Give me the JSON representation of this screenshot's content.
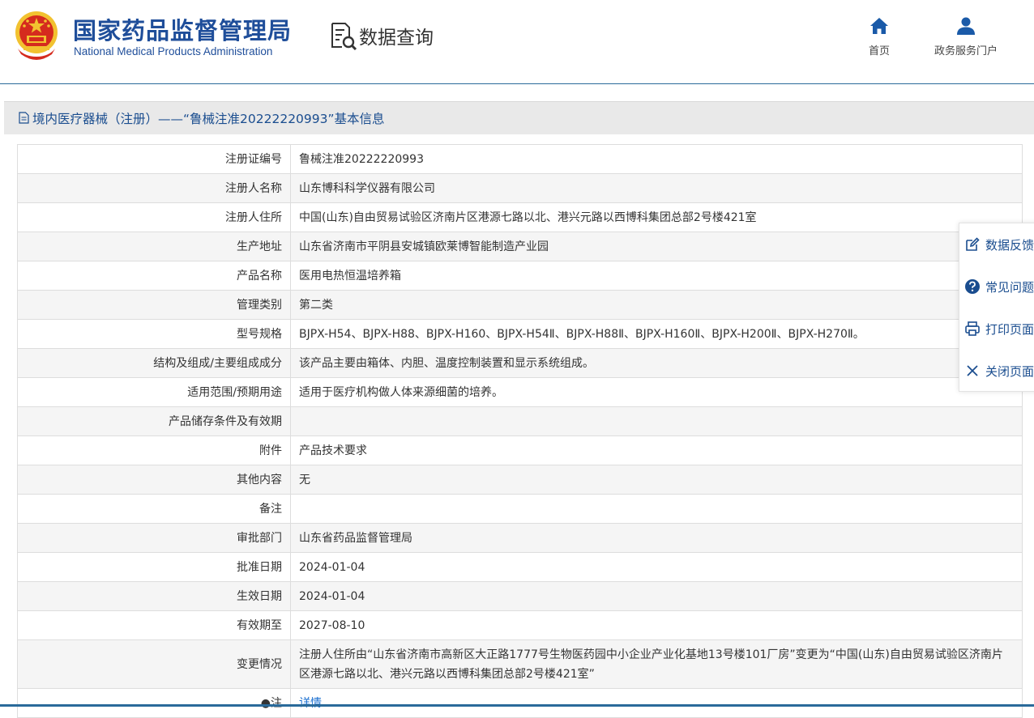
{
  "header": {
    "logo_cn": "国家药品监督管理局",
    "logo_en": "National Medical Products Administration",
    "section": "数据查询",
    "nav": {
      "home": "首页",
      "portal": "政务服务门户"
    }
  },
  "page_title": "境内医疗器械（注册）——“鲁械注准20222220993”基本信息",
  "rows": [
    {
      "label": "注册证编号",
      "value": "鲁械注准20222220993"
    },
    {
      "label": "注册人名称",
      "value": "山东博科科学仪器有限公司"
    },
    {
      "label": "注册人住所",
      "value": "中国(山东)自由贸易试验区济南片区港源七路以北、港兴元路以西博科集团总部2号楼421室"
    },
    {
      "label": "生产地址",
      "value": "山东省济南市平阴县安城镇欧莱博智能制造产业园"
    },
    {
      "label": "产品名称",
      "value": "医用电热恒温培养箱"
    },
    {
      "label": "管理类别",
      "value": "第二类"
    },
    {
      "label": "型号规格",
      "value": "BJPX-H54、BJPX-H88、BJPX-H160、BJPX-H54Ⅱ、BJPX-H88Ⅱ、BJPX-H160Ⅱ、BJPX-H200Ⅱ、BJPX-H270Ⅱ。"
    },
    {
      "label": "结构及组成/主要组成成分",
      "value": "该产品主要由箱体、内胆、温度控制装置和显示系统组成。"
    },
    {
      "label": "适用范围/预期用途",
      "value": "适用于医疗机构做人体来源细菌的培养。"
    },
    {
      "label": "产品储存条件及有效期",
      "value": ""
    },
    {
      "label": "附件",
      "value": "产品技术要求"
    },
    {
      "label": "其他内容",
      "value": "无"
    },
    {
      "label": "备注",
      "value": ""
    },
    {
      "label": "审批部门",
      "value": "山东省药品监督管理局"
    },
    {
      "label": "批准日期",
      "value": "2024-01-04"
    },
    {
      "label": "生效日期",
      "value": "2024-01-04"
    },
    {
      "label": "有效期至",
      "value": "2027-08-10"
    },
    {
      "label": "变更情况",
      "value": "注册人住所由“山东省济南市高新区大正路1777号生物医药园中小企业产业化基地13号楼101厂房”变更为“中国(山东)自由贸易试验区济南片区港源七路以北、港兴元路以西博科集团总部2号楼421室”"
    },
    {
      "label": "●注",
      "value": "详情"
    }
  ],
  "side_panel": {
    "feedback": "数据反馈",
    "faq": "常见问题",
    "print": "打印页面",
    "close": "关闭页面"
  },
  "colors": {
    "brand_blue": "#1f4e9a",
    "link_blue": "#1a6fd0",
    "emblem_red": "#d52b1e",
    "emblem_gold": "#f2c230"
  }
}
